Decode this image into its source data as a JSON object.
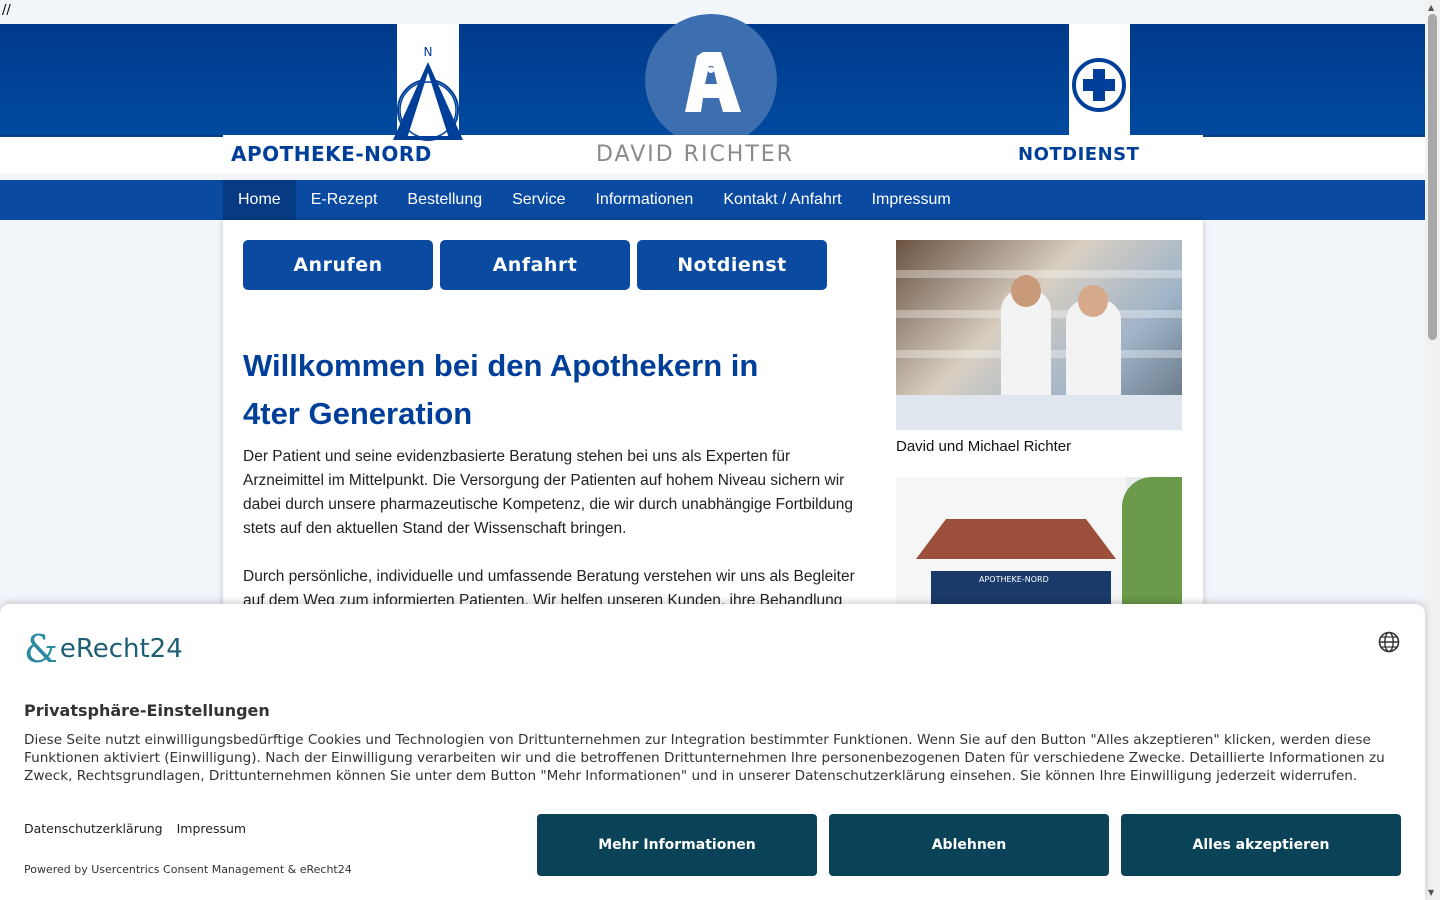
{
  "top_text": "//",
  "header": {
    "brand_left": "APOTHEKE-NORD",
    "logo_letter": "N",
    "brand_center": "DAVID RICHTER",
    "brand_right": "NOTDIENST"
  },
  "nav": {
    "items": [
      {
        "label": "Home"
      },
      {
        "label": "E-Rezept"
      },
      {
        "label": "Bestellung"
      },
      {
        "label": "Service"
      },
      {
        "label": "Informationen"
      },
      {
        "label": "Kontakt / Anfahrt"
      },
      {
        "label": "Impressum"
      }
    ]
  },
  "actions": {
    "call": "Anrufen",
    "route": "Anfahrt",
    "emergency": "Notdienst"
  },
  "main": {
    "heading": "Willkommen bei den Apothekern in 4ter Generation",
    "para1": "Der Patient und seine evidenzbasierte Beratung stehen bei uns als Experten für Arzneimittel im Mittelpunkt. Die Versorgung der Patienten auf hohem Niveau sichern wir dabei durch unsere pharmazeutische Kompetenz, die wir durch unabhängige Fortbildung stets auf den aktuellen Stand der Wissenschaft bringen.",
    "para2": "Durch persönliche, individuelle und umfassende Beratung verstehen wir uns als Begleiter auf dem Weg zum informierten Patienten. Wir helfen unseren Kunden, ihre Behandlung zu"
  },
  "sidebar": {
    "photo1_caption": "David und Michael Richter",
    "shop_sign": "APOTHEKE-NORD"
  },
  "consent": {
    "logo_text": "eRecht24",
    "title": "Privatsphäre-Einstellungen",
    "text": "Diese Seite nutzt einwilligungsbedürftige Cookies und Technologien von Drittunternehmen zur Integration bestimmter Funktionen. Wenn Sie auf den Button \"Alles akzeptieren\" klicken, werden diese Funktionen aktiviert (Einwilligung). Nach der Einwilligung verarbeiten wir und die betroffenen Drittunternehmen Ihre personenbezogenen Daten für verschiedene Zwecke. Detaillierte Informationen zu Zweck, Rechtsgrundlagen, Drittunternehmen können Sie unter dem Button \"Mehr Informationen\" und in unserer Datenschutzerklärung einsehen. Sie können Ihre Einwilligung jederzeit widerrufen.",
    "link_privacy": "Datenschutzerklärung",
    "link_imprint": "Impressum",
    "powered": "Powered by Usercentrics Consent Management & eRecht24",
    "btn_more": "Mehr Informationen",
    "btn_decline": "Ablehnen",
    "btn_accept": "Alles akzeptieren"
  },
  "colors": {
    "brand_blue": "#0a4aa0",
    "consent_button": "#0a4358"
  }
}
